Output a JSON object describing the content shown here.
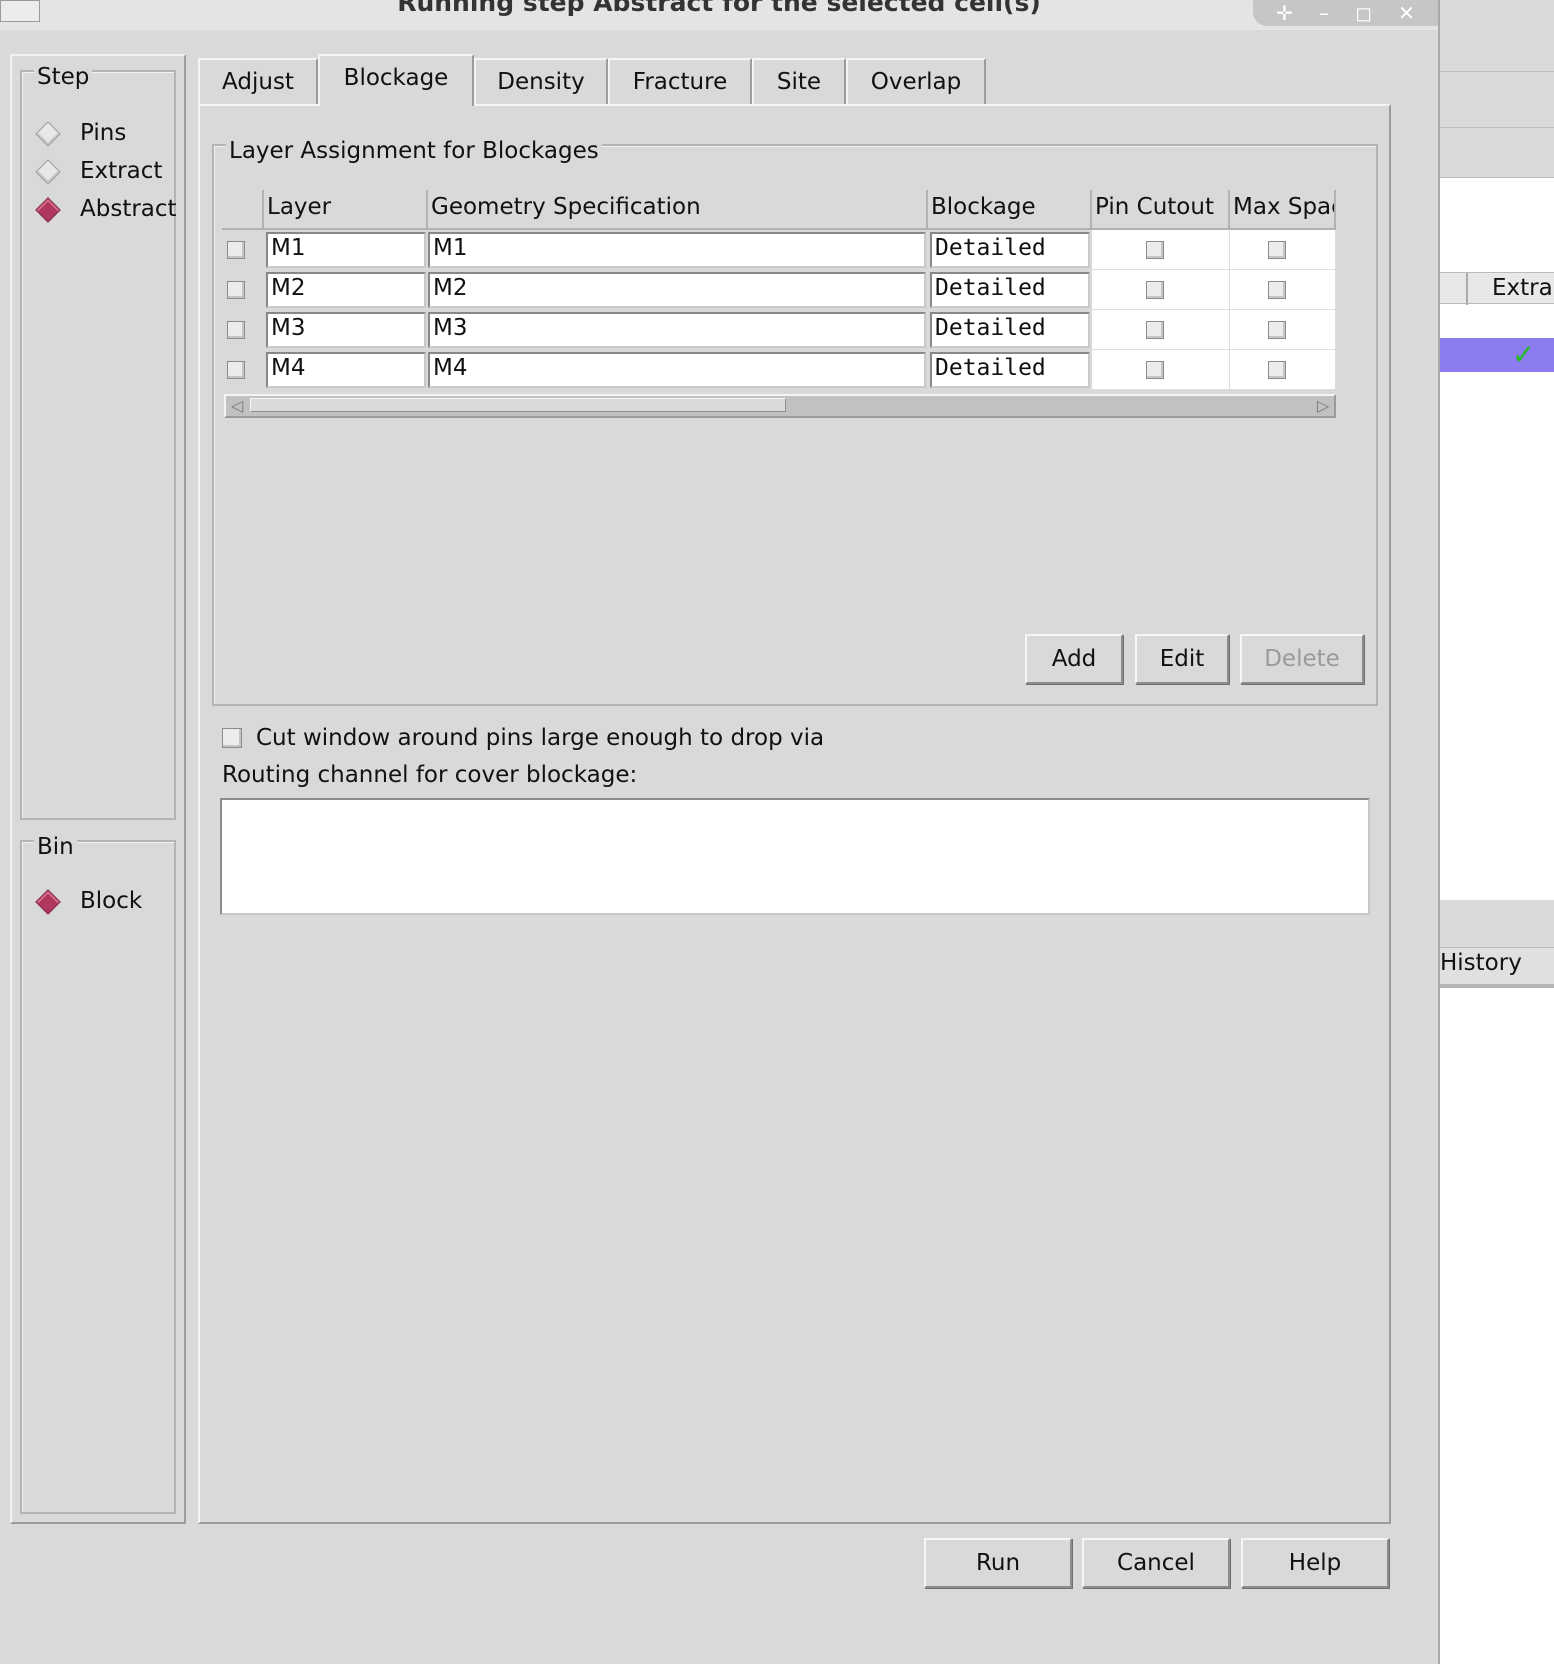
{
  "window": {
    "title": "Running step Abstract for the selected cell(s)",
    "controls": [
      "✛",
      "–",
      "◻",
      "✕"
    ]
  },
  "step_group": {
    "legend": "Step",
    "options": [
      {
        "label": "Pins",
        "selected": false
      },
      {
        "label": "Extract",
        "selected": false
      },
      {
        "label": "Abstract",
        "selected": true
      }
    ]
  },
  "bin_group": {
    "legend": "Bin",
    "options": [
      {
        "label": "Block",
        "selected": true
      }
    ]
  },
  "tabs": [
    {
      "label": "Adjust",
      "active": false
    },
    {
      "label": "Blockage",
      "active": true
    },
    {
      "label": "Density",
      "active": false
    },
    {
      "label": "Fracture",
      "active": false
    },
    {
      "label": "Site",
      "active": false
    },
    {
      "label": "Overlap",
      "active": false
    }
  ],
  "blockage": {
    "group_legend": "Layer Assignment for Blockages",
    "columns": [
      "",
      "Layer",
      "Geometry Specification",
      "Blockage",
      "Pin Cutout",
      "Max Spac"
    ],
    "rows": [
      {
        "layer": "M1",
        "geometry": "M1",
        "blockage": "Detailed",
        "selected": false,
        "pin_cutout": false,
        "max_spacing": false
      },
      {
        "layer": "M2",
        "geometry": "M2",
        "blockage": "Detailed",
        "selected": false,
        "pin_cutout": false,
        "max_spacing": false
      },
      {
        "layer": "M3",
        "geometry": "M3",
        "blockage": "Detailed",
        "selected": false,
        "pin_cutout": false,
        "max_spacing": false
      },
      {
        "layer": "M4",
        "geometry": "M4",
        "blockage": "Detailed",
        "selected": false,
        "pin_cutout": false,
        "max_spacing": false
      }
    ],
    "buttons": {
      "add": "Add",
      "edit": "Edit",
      "delete": "Delete"
    },
    "cut_window_label": "Cut window around pins large enough to drop via",
    "cut_window_checked": false,
    "routing_channel_label": "Routing channel for cover blockage:",
    "routing_channel_value": ""
  },
  "footer": {
    "run": "Run",
    "cancel": "Cancel",
    "help": "Help"
  },
  "background_window": {
    "column_label": "Extrac",
    "checkmark": "✓",
    "history_label": "History",
    "selection_color": "#8b7cf0"
  }
}
